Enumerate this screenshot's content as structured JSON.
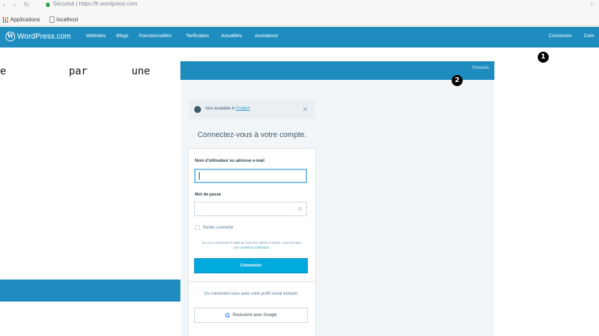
{
  "browser": {
    "nav_glyphs": "‹ › ↻",
    "url_secure_label": "Sécurisé",
    "url": "https://fr.wordpress.com",
    "right_glyph": "⚐"
  },
  "bookmarks": [
    {
      "label": "Applications"
    },
    {
      "label": "localhost"
    }
  ],
  "masterbar": {
    "logo_text": "WordPress.com",
    "nav": [
      "Websites",
      "Blogs",
      "Fonctionnalités",
      "Tarification",
      "Actualités",
      "Assistance"
    ],
    "connexion": "Connexion",
    "truncated": "Com"
  },
  "document": {
    "text_fragment": [
      "e",
      "par",
      "une"
    ]
  },
  "markers": [
    "1",
    "2"
  ],
  "login": {
    "signup_label": "S'inscrire",
    "lang_notice_prefix": "Also available in",
    "lang_link": "English",
    "close_glyph": "×",
    "title": "Connectez-vous à votre compte.",
    "username_label": "Nom d'utilisateur ou adresse e-mail",
    "password_label": "Mot de passe",
    "remember_label": "Rester connecté",
    "terms_text": "En vous connectant à l'aide de l'une des options ci-après, vous acceptez",
    "terms_link": "nos conditions d'utilisation.",
    "submit_label": "Connexion",
    "social_text": "Ou connectez-vous avec votre profil social existant :",
    "google_label": "Poursuivre avec Google"
  },
  "colors": {
    "wp_blue": "#1e8cbe",
    "button_blue": "#00aadc",
    "page_gray": "#f3f6f8"
  }
}
